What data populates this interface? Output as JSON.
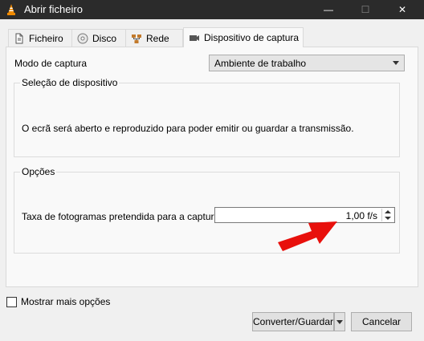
{
  "window": {
    "title": "Abrir ficheiro",
    "minimize_glyph": "—",
    "maximize_glyph": "☐",
    "close_glyph": "✕"
  },
  "tabs": [
    {
      "label": "Ficheiro",
      "icon": "file-icon"
    },
    {
      "label": "Disco",
      "icon": "disc-icon"
    },
    {
      "label": "Rede",
      "icon": "network-icon"
    },
    {
      "label": "Dispositivo de captura",
      "icon": "capture-device-icon",
      "active": true
    }
  ],
  "capture": {
    "mode_label": "Modo de captura",
    "mode_value": "Ambiente de trabalho"
  },
  "device_group": {
    "title": "Seleção de dispositivo",
    "description": "O ecrã será aberto e reproduzido para poder emitir ou guardar a transmissão."
  },
  "options_group": {
    "title": "Opções",
    "fps_label": "Taxa de fotogramas pretendida para a captura.",
    "fps_value": "1,00 f/s"
  },
  "footer": {
    "more_options_label": "Mostrar mais opções",
    "more_options_checked": false,
    "convert_label": "Converter/Guardar",
    "cancel_label": "Cancelar"
  },
  "colors": {
    "titlebar": "#2b2b2b",
    "vlc_orange": "#f08a00",
    "annotation_arrow": "#e8100c"
  }
}
